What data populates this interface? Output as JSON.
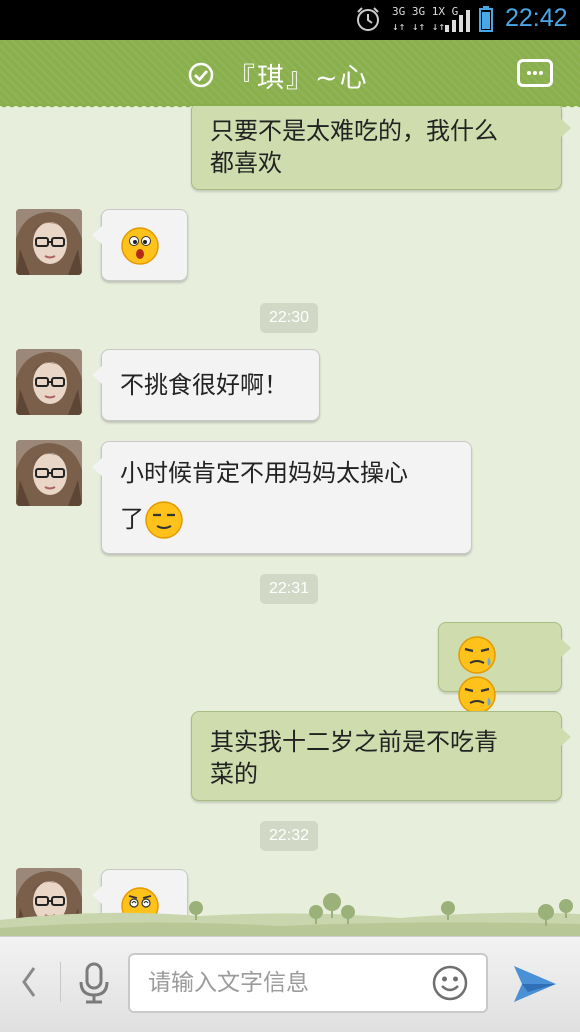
{
  "status_bar": {
    "time": "22:42",
    "network_top": "3G 3G 1X G",
    "network_bottom": "↓↑ ↓↑ ↓↑",
    "icons": [
      "alarm-icon",
      "signal-icon",
      "battery-icon"
    ]
  },
  "header": {
    "title": "『琪』~心",
    "online_icon": "check-circle-icon",
    "more_icon": "more-icon"
  },
  "messages": [
    {
      "side": "out",
      "text_line1": "只要不是太难吃的，我什么",
      "text_line2": "都喜欢"
    },
    {
      "side": "in",
      "emoji": "surprised-emoji"
    },
    {
      "timestamp": "22:30"
    },
    {
      "side": "in",
      "text": "不挑食很好啊！"
    },
    {
      "side": "in",
      "text_line1": "小时候肯定不用妈妈太操心",
      "text_line2": "了",
      "emoji": "content-emoji"
    },
    {
      "timestamp": "22:31"
    },
    {
      "side": "out",
      "emojis": [
        "sweat-emoji",
        "sweat-emoji"
      ]
    },
    {
      "side": "out",
      "text_line1": "其实我十二岁之前是不吃青",
      "text_line2": "菜的"
    },
    {
      "timestamp": "22:32"
    },
    {
      "side": "in",
      "emoji": "dizzy-emoji"
    }
  ],
  "input_bar": {
    "placeholder": "请输入文字信息"
  },
  "colors": {
    "header": "#8ab04e",
    "chat_background": "#e8eedc",
    "bubble_out": "#cedcae",
    "bubble_in": "#f3f3f3",
    "status_time": "#49a7e6"
  }
}
